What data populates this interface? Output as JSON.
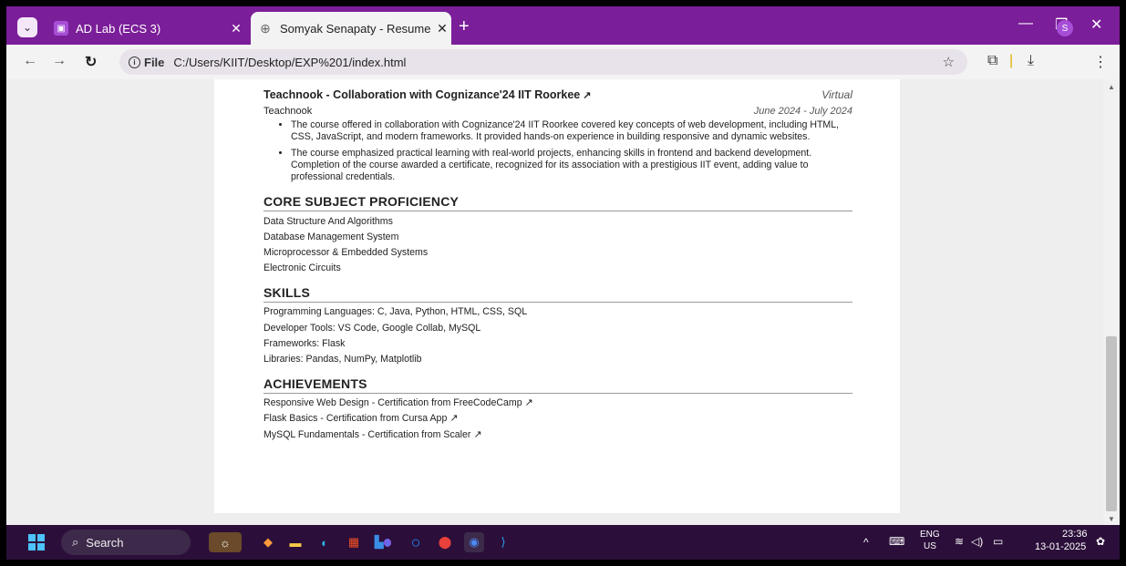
{
  "browser": {
    "tabs": [
      {
        "title": "AD Lab (ECS 3)",
        "active": false
      },
      {
        "title": "Somyak Senapaty - Resume",
        "active": true
      }
    ],
    "new_tab_symbol": "+",
    "address": {
      "scheme_chip": "File",
      "url": "C:/Users/KIIT/Desktop/EXP%201/index.html"
    },
    "profile_initial": "S",
    "colors": {
      "tab_bar": "#7b1e99",
      "accent": "#a64ed6"
    }
  },
  "resume": {
    "experience": {
      "title": "Teachnook - Collaboration with Cognizance'24 IIT Roorkee",
      "location": "Virtual",
      "company": "Teachnook",
      "dates": "June 2024 - July 2024",
      "bullets": [
        "The course offered in collaboration with Cognizance'24 IIT Roorkee covered key concepts of web development, including HTML, CSS, JavaScript, and modern frameworks. It provided hands-on experience in building responsive and dynamic websites.",
        "The course emphasized practical learning with real-world projects, enhancing skills in frontend and backend development. Completion of the course awarded a certificate, recognized for its association with a prestigious IIT event, adding value to professional credentials."
      ]
    },
    "core": {
      "heading": "CORE SUBJECT PROFICIENCY",
      "items": [
        "Data Structure And Algorithms",
        "Database Management System",
        "Microprocessor & Embedded Systems",
        "Electronic Circuits"
      ]
    },
    "skills": {
      "heading": "SKILLS",
      "items": [
        "Programming Languages: C, Java, Python, HTML, CSS, SQL",
        "Developer Tools: VS Code, Google Collab, MySQL",
        "Frameworks: Flask",
        "Libraries: Pandas, NumPy, Matplotlib"
      ]
    },
    "achievements": {
      "heading": "ACHIEVEMENTS",
      "items": [
        "Responsive Web Design - Certification from FreeCodeCamp",
        "Flask Basics - Certification from Cursa App",
        "MySQL Fundamentals - Certification from Scaler"
      ]
    }
  },
  "taskbar": {
    "search_label": "Search",
    "language": "ENG",
    "region": "US",
    "time": "23:36",
    "date": "13-01-2025",
    "notification_badge": "1"
  }
}
